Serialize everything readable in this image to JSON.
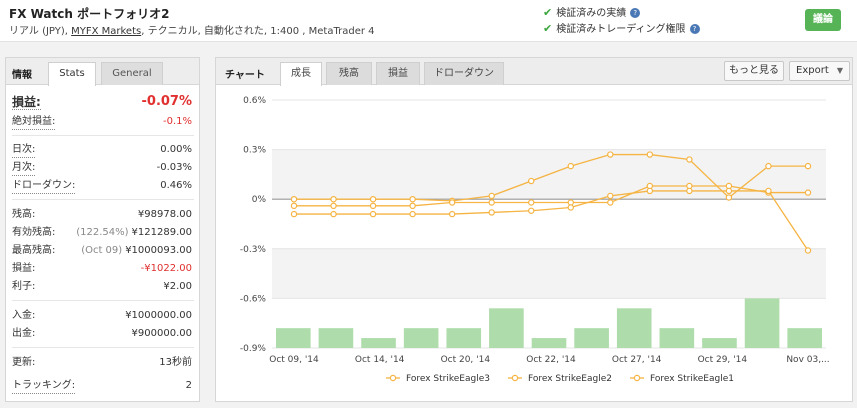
{
  "header": {
    "title": "FX Watch ポートフォリオ2",
    "subtitle_prefix": "リアル (JPY), ",
    "broker": "MYFX Markets",
    "subtitle_suffix": ", テクニカル, 自動化された, 1:400 , MetaTrader 4",
    "verify1": "検証済みの実績",
    "verify2": "検証済みトレーディング権限",
    "discuss_button": "議論"
  },
  "left_panel": {
    "label": "情報",
    "tabs": [
      "Stats",
      "General"
    ],
    "stats": {
      "gain_label": "損益:",
      "gain_value": "-0.07%",
      "abs_gain_label": "絶対損益:",
      "abs_gain_value": "-0.1%",
      "daily_label": "日次:",
      "daily_value": "0.00%",
      "monthly_label": "月次:",
      "monthly_value": "-0.03%",
      "drawdown_label": "ドローダウン:",
      "drawdown_value": "0.46%",
      "balance_label": "残高:",
      "balance_value": "¥98978.00",
      "equity_label": "有効残高:",
      "equity_note": "(122.54%)",
      "equity_value": "¥121289.00",
      "highest_label": "最高残高:",
      "highest_note": "(Oct 09)",
      "highest_value": "¥1000093.00",
      "profit_label": "損益:",
      "profit_value": "-¥1022.00",
      "interest_label": "利子:",
      "interest_value": "¥2.00",
      "deposits_label": "入金:",
      "deposits_value": "¥1000000.00",
      "withdrawals_label": "出金:",
      "withdrawals_value": "¥900000.00",
      "updated_label": "更新:",
      "updated_value": "13秒前",
      "tracking_label": "トラッキング:",
      "tracking_value": "2"
    }
  },
  "right_panel": {
    "label": "チャート",
    "tabs": [
      "成長",
      "残高",
      "損益",
      "ドローダウン"
    ],
    "more_button": "もっと見る",
    "export_button": "Export"
  },
  "colors": {
    "line": "#f5b443",
    "bar": "#aedcaa",
    "negative": "#e03030",
    "check": "#3aa63a"
  },
  "chart_data": {
    "type": "line",
    "categories": [
      "Oct 09, '14",
      "",
      "",
      "Oct 14, '14",
      "",
      "",
      "Oct 20, '14",
      "",
      "",
      "Oct 22, '14",
      "",
      "",
      "Oct 27, '14",
      "",
      "",
      "Oct 29, '14",
      "",
      "",
      "Nov 03,..."
    ],
    "x_tick_labels": [
      "Oct 09, '14",
      "Oct 14, '14",
      "Oct 20, '14",
      "Oct 22, '14",
      "Oct 27, '14",
      "Oct 29, '14",
      "Nov 03,..."
    ],
    "ylim": [
      -0.9,
      0.6
    ],
    "y_ticks": [
      "0.6%",
      "0.3%",
      "0%",
      "-0.3%",
      "-0.6%",
      "-0.9%"
    ],
    "series": [
      {
        "name": "Forex StrikeEagle3",
        "values": [
          0,
          0,
          0,
          0,
          -0.01,
          0.02,
          0.11,
          0.2,
          0.27,
          0.27,
          0.24,
          0.01,
          0.2,
          0.2
        ]
      },
      {
        "name": "Forex StrikeEagle2",
        "values": [
          -0.04,
          -0.04,
          -0.04,
          -0.04,
          -0.02,
          -0.02,
          -0.02,
          -0.02,
          -0.02,
          0.08,
          0.08,
          0.08,
          0.04,
          0.04
        ]
      },
      {
        "name": "Forex StrikeEagle1",
        "values": [
          -0.09,
          -0.09,
          -0.09,
          -0.09,
          -0.09,
          -0.08,
          -0.07,
          -0.05,
          0.02,
          0.05,
          0.05,
          0.05,
          0.05,
          -0.31
        ]
      }
    ],
    "bars": [
      -0.78,
      -0.78,
      -0.84,
      -0.78,
      -0.78,
      -0.66,
      -0.84,
      -0.78,
      -0.66,
      -0.78,
      -0.84,
      -0.6,
      -0.78
    ],
    "grid": true,
    "legend": "bottom"
  }
}
